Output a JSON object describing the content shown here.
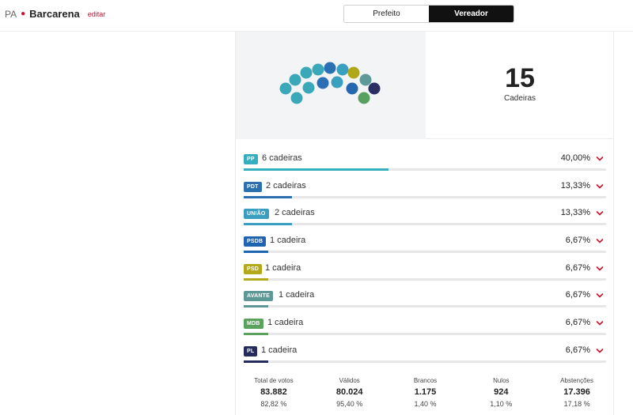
{
  "header": {
    "state": "PA",
    "city": "Barcarena",
    "edit_label": "editar",
    "tabs": [
      {
        "label": "Prefeito",
        "active": false
      },
      {
        "label": "Vereador",
        "active": true
      }
    ]
  },
  "seats": {
    "count": "15",
    "label": "Cadeiras",
    "dots": [
      "#3aa8b8",
      "#3aa8b8",
      "#3aa8b8",
      "#3aa8b8",
      "#3aa8b8",
      "#3aa8b8",
      "#2b70b5",
      "#2b70b5",
      "#3aa0c0",
      "#3aa0c0",
      "#2668b0",
      "#b0a818",
      "#5e9a98",
      "#58a060",
      "#2a2e60"
    ]
  },
  "parties": [
    {
      "abbr": "PP",
      "seats_text": "6 cadeiras",
      "percent": "40,00%",
      "share": 40.0,
      "color": "#35aebe"
    },
    {
      "abbr": "PDT",
      "seats_text": "2 cadeiras",
      "percent": "13,33%",
      "share": 13.33,
      "color": "#2a70b0"
    },
    {
      "abbr": "UNIÃO",
      "seats_text": "2 cadeiras",
      "percent": "13,33%",
      "share": 13.33,
      "color": "#3a9ec0"
    },
    {
      "abbr": "PSDB",
      "seats_text": "1 cadeira",
      "percent": "6,67%",
      "share": 6.67,
      "color": "#1f64b0"
    },
    {
      "abbr": "PSD",
      "seats_text": "1 cadeira",
      "percent": "6,67%",
      "share": 6.67,
      "color": "#b3a91a"
    },
    {
      "abbr": "AVANTE",
      "seats_text": "1 cadeira",
      "percent": "6,67%",
      "share": 6.67,
      "color": "#5e9896"
    },
    {
      "abbr": "MDB",
      "seats_text": "1 cadeira",
      "percent": "6,67%",
      "share": 6.67,
      "color": "#5aa25e"
    },
    {
      "abbr": "PL",
      "seats_text": "1 cadeira",
      "percent": "6,67%",
      "share": 6.67,
      "color": "#252b5c"
    }
  ],
  "totals": [
    {
      "label": "Total de votos",
      "value": "83.882",
      "percent": "82,82 %"
    },
    {
      "label": "Válidos",
      "value": "80.024",
      "percent": "95,40 %"
    },
    {
      "label": "Brancos",
      "value": "1.175",
      "percent": "1,40 %"
    },
    {
      "label": "Nulos",
      "value": "924",
      "percent": "1,10 %"
    },
    {
      "label": "Abstenções",
      "value": "17.396",
      "percent": "17,18 %"
    }
  ],
  "colors": {
    "accent": "#c8102e",
    "chevron": "#c8102e"
  }
}
